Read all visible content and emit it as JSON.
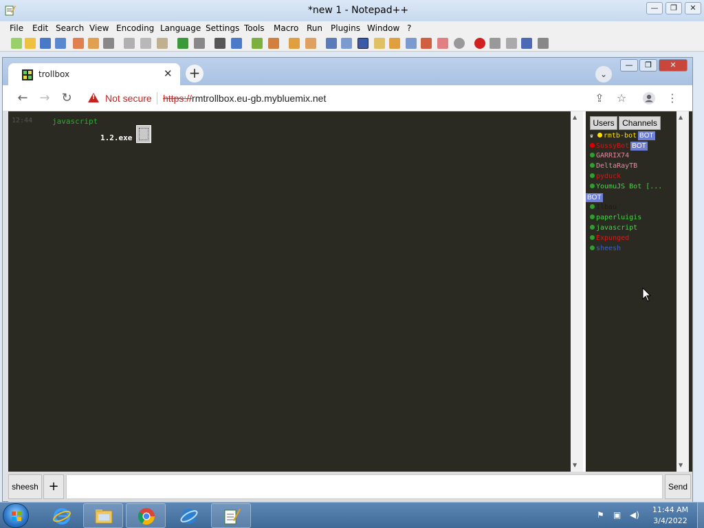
{
  "notepad": {
    "title": "*new 1 - Notepad++",
    "menu": [
      "File",
      "Edit",
      "Search",
      "View",
      "Encoding",
      "Language",
      "Settings",
      "Tools",
      "Macro",
      "Run",
      "Plugins",
      "Window",
      "?"
    ]
  },
  "chrome": {
    "tab_title": "trollbox",
    "tab_close": "✕",
    "new_tab": "+",
    "security_label": "Not secure",
    "url_scheme": "https://",
    "url_host": "rmtrollbox.eu-gb.mybluemix.net"
  },
  "chat": {
    "message": {
      "time": "12:44",
      "nick": "javascript",
      "text": "1.2.exe"
    }
  },
  "sidebar": {
    "tab_users": "Users",
    "tab_channels": "Channels",
    "bot_badge": "BOT",
    "users": [
      {
        "name": "rmtb-bot",
        "color": "#ffe000",
        "dot": "#ffe000",
        "bot": true
      },
      {
        "name": "SussyBot",
        "color": "#d01818",
        "dot": "#e00000",
        "bot": true
      },
      {
        "name": "GARRIX74",
        "color": "#e58aa0",
        "dot": "#2e9e2e",
        "bot": false
      },
      {
        "name": "DeltaRayTB",
        "color": "#e58aa0",
        "dot": "#2e9e2e",
        "bot": false
      },
      {
        "name": "pyduck",
        "color": "#d01818",
        "dot": "#2e9e2e",
        "bot": false
      },
      {
        "name": "YoumuJS Bot [...",
        "color": "#45d845",
        "dot": "#2e9e2e",
        "bot": true
      },
      {
        "name": "Ilbau",
        "color": "#1a1a1a",
        "dot": "#2e9e2e",
        "bot": false
      },
      {
        "name": "paperluigis",
        "color": "#45d845",
        "dot": "#2e9e2e",
        "bot": false
      },
      {
        "name": "javascript",
        "color": "#45d845",
        "dot": "#2e9e2e",
        "bot": false
      },
      {
        "name": "Expunged",
        "color": "#e01818",
        "dot": "#2e9e2e",
        "bot": false
      },
      {
        "name": "sheesh",
        "color": "#3a5fd8",
        "dot": "#2e9e2e",
        "bot": false
      }
    ]
  },
  "bottom": {
    "nick": "sheesh",
    "plus": "+",
    "input_value": "",
    "send": "Send"
  },
  "taskbar": {
    "time": "11:44 AM",
    "date": "3/4/2022"
  }
}
